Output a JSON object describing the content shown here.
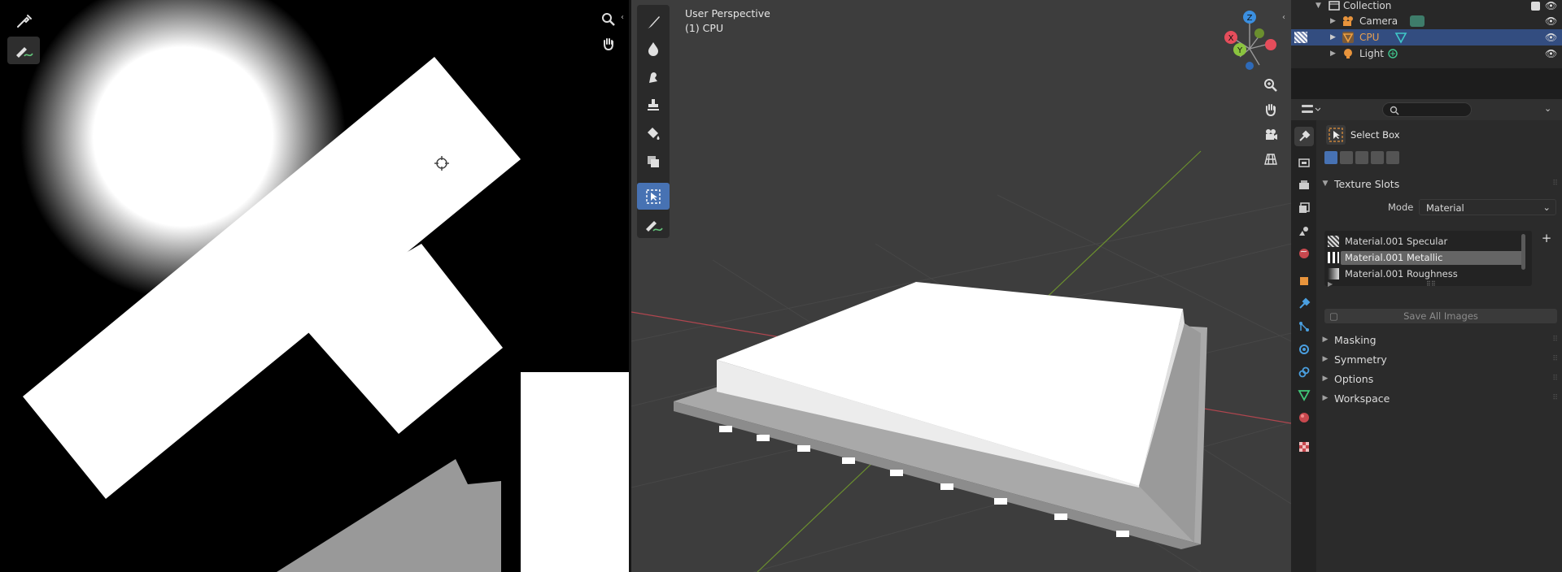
{
  "image_editor": {
    "tools": [
      {
        "icon": "eyedropper-icon",
        "active": false
      },
      {
        "icon": "annotate-icon",
        "active": true
      }
    ],
    "nav": [
      {
        "icon": "zoom-icon"
      },
      {
        "icon": "hand-pan-icon"
      }
    ]
  },
  "viewport": {
    "perspective_label": "User Perspective",
    "object_label": "(1) CPU",
    "tools": [
      {
        "icon": "brush-draw-icon"
      },
      {
        "icon": "soften-icon"
      },
      {
        "icon": "smear-icon"
      },
      {
        "icon": "clone-stamp-icon"
      },
      {
        "icon": "fill-bucket-icon"
      },
      {
        "icon": "mask-icon"
      },
      {
        "icon": "select-box-icon",
        "active": true
      },
      {
        "icon": "annotate-icon"
      }
    ],
    "gizmo": {
      "x": "X",
      "y": "Y",
      "z": "Z"
    },
    "nav": [
      {
        "icon": "zoom-icon"
      },
      {
        "icon": "hand-pan-icon"
      },
      {
        "icon": "camera-view-icon"
      },
      {
        "icon": "grid-ortho-icon"
      }
    ]
  },
  "outliner": {
    "collection_label": "Collection",
    "rows": [
      {
        "label": "Camera",
        "icon": "camera-object-icon",
        "data_icon": "camera-data-icon"
      },
      {
        "label": "CPU",
        "icon": "mesh-object-icon",
        "data_icon": "mesh-data-icon",
        "selected": true
      },
      {
        "label": "Light",
        "icon": "light-object-icon",
        "data_icon": "light-data-icon"
      }
    ]
  },
  "properties": {
    "search_placeholder": "",
    "tool_name": "Select Box",
    "texture_slots": {
      "title": "Texture Slots",
      "mode_label": "Mode",
      "mode_value": "Material",
      "slots": [
        {
          "label": "Material.001 Specular",
          "selected": false
        },
        {
          "label": "Material.001 Metallic",
          "selected": true
        },
        {
          "label": "Material.001 Roughness",
          "selected": false
        }
      ],
      "save_button": "Save All Images"
    },
    "panels": [
      "Masking",
      "Symmetry",
      "Options",
      "Workspace"
    ],
    "tabs": [
      "tool-icon",
      "render-icon",
      "output-icon",
      "view-layer-icon",
      "scene-icon",
      "world-icon",
      "object-icon",
      "modifier-icon",
      "particles-icon",
      "physics-icon",
      "constraints-icon",
      "data-icon",
      "material-icon",
      "texture-icon"
    ]
  },
  "colors": {
    "accent": "#4772b3",
    "selected_row": "#334d80",
    "axis_x": "#e54d5b",
    "axis_y": "#8bc43f",
    "axis_z": "#3b8fe0"
  }
}
